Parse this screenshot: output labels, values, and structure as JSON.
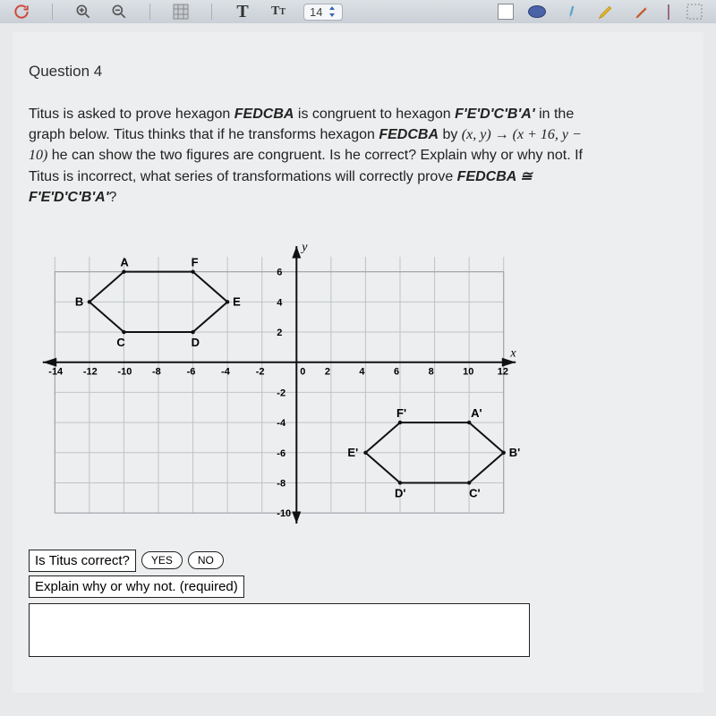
{
  "toolbar": {
    "page_current": "14"
  },
  "question": {
    "label": "Question 4",
    "prompt_html": "Titus is asked to prove hexagon <span class='ital'>FEDCBA</span> is congruent to hexagon <span class='ital'>F'E'D'C'B'A'</span> in the graph below. Titus thinks that if he transforms hexagon <span class='ital'>FEDCBA</span> by <span class='trans'>(x, y) → (x + 16, y − 10)</span> he can show the two figures are congruent. Is he correct? Explain why or why not. If Titus is incorrect, what series of transformations will correctly prove <span class='ital'>FEDCBA ≅ F'E'D'C'B'A'</span>?"
  },
  "graph": {
    "x_label": "x",
    "y_label": "y",
    "x_ticks": [
      -14,
      -12,
      -10,
      -8,
      -6,
      -4,
      -2,
      0,
      2,
      4,
      6,
      8,
      10,
      12
    ],
    "y_ticks": [
      6,
      4,
      2,
      -2,
      -4,
      -6,
      -8,
      -10
    ],
    "hex1": {
      "labels": {
        "A": "A",
        "B": "B",
        "C": "C",
        "D": "D",
        "E": "E",
        "F": "F"
      },
      "points": {
        "A": [
          -10,
          6
        ],
        "F": [
          -6,
          6
        ],
        "E": [
          -4,
          4
        ],
        "D": [
          -6,
          2
        ],
        "C": [
          -10,
          2
        ],
        "B": [
          -12,
          4
        ]
      }
    },
    "hex2": {
      "labels": {
        "A'": "A'",
        "B'": "B'",
        "C'": "C'",
        "D'": "D'",
        "E'": "E'",
        "F'": "F'"
      },
      "points": {
        "F'": [
          6,
          -4
        ],
        "A'": [
          10,
          -4
        ],
        "B'": [
          12,
          -6
        ],
        "C'": [
          10,
          -8
        ],
        "D'": [
          6,
          -8
        ],
        "E'": [
          4,
          -6
        ]
      }
    }
  },
  "answer": {
    "question": "Is Titus correct?",
    "yes": "YES",
    "no": "NO",
    "explain": "Explain why or why not. (required)"
  },
  "chart_data": {
    "type": "diagram",
    "description": "coordinate grid with two congruent hexagons",
    "axis_x_range": [
      -15,
      13
    ],
    "axis_y_range": [
      -11,
      8
    ],
    "shapes": [
      {
        "name": "FEDCBA",
        "vertices": [
          [
            -10,
            6
          ],
          [
            -6,
            6
          ],
          [
            -4,
            4
          ],
          [
            -6,
            2
          ],
          [
            -10,
            2
          ],
          [
            -12,
            4
          ]
        ],
        "vertex_labels": [
          "A",
          "F",
          "E",
          "D",
          "C",
          "B"
        ]
      },
      {
        "name": "F'E'D'C'B'A'",
        "vertices": [
          [
            6,
            -4
          ],
          [
            10,
            -4
          ],
          [
            12,
            -6
          ],
          [
            10,
            -8
          ],
          [
            6,
            -8
          ],
          [
            4,
            -6
          ]
        ],
        "vertex_labels": [
          "F'",
          "A'",
          "B'",
          "C'",
          "D'",
          "E'"
        ]
      }
    ]
  }
}
